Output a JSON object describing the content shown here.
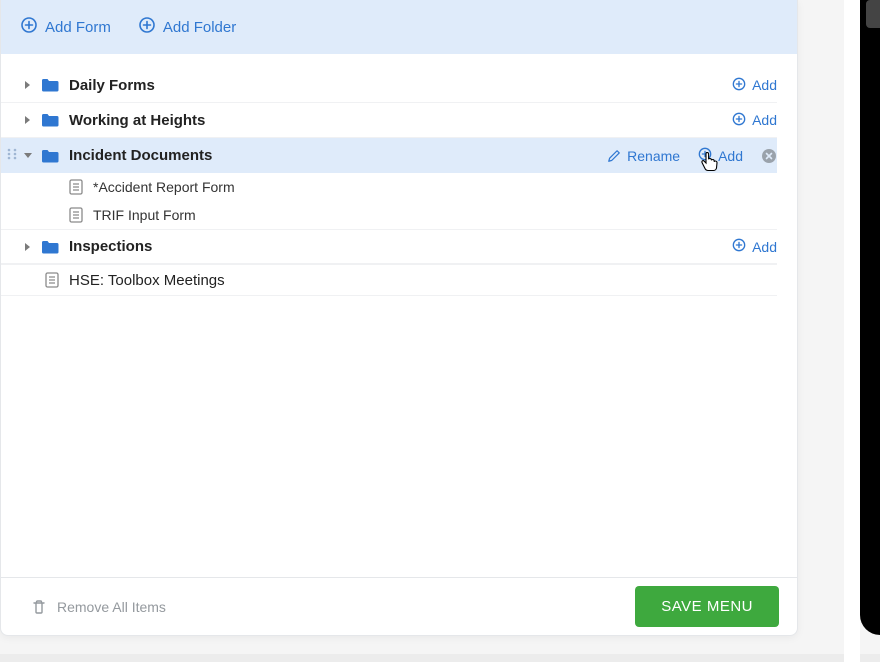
{
  "header": {
    "add_form_label": "Add Form",
    "add_folder_label": "Add Folder"
  },
  "tree": {
    "folders": [
      {
        "label": "Daily Forms",
        "add_label": "Add"
      },
      {
        "label": "Working at Heights",
        "add_label": "Add"
      },
      {
        "label": "Incident Documents",
        "rename_label": "Rename",
        "add_label": "Add",
        "children": [
          {
            "label": "*Accident Report Form"
          },
          {
            "label": "TRIF Input Form"
          }
        ]
      },
      {
        "label": "Inspections",
        "add_label": "Add"
      }
    ],
    "root_files": [
      {
        "label": "HSE: Toolbox Meetings"
      }
    ]
  },
  "footer": {
    "remove_all_label": "Remove All Items",
    "save_label": "SAVE MENU"
  },
  "colors": {
    "accent": "#2f77d1",
    "highlight_bg": "#dfebfa",
    "save_green": "#3ea93e"
  }
}
